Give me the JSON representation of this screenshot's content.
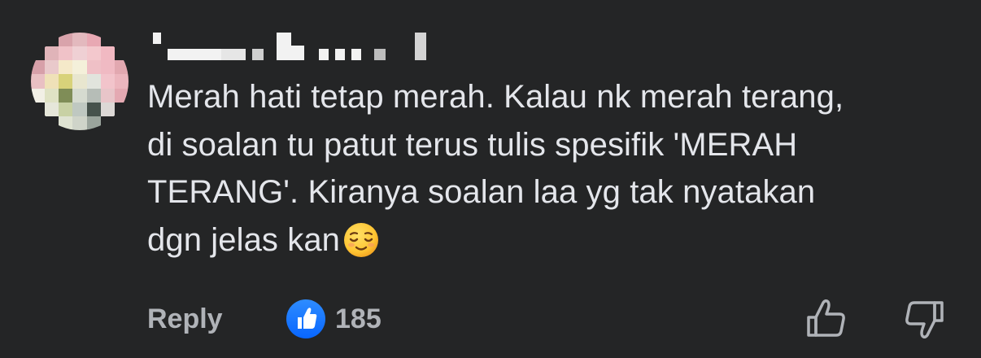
{
  "comment": {
    "author_name": "",
    "text_lines": [
      "Merah hati tetap merah. Kalau nk merah terang,",
      "di soalan tu patut terus tulis spesifik 'MERAH",
      "TERANG'. Kiranya soalan laa yg tak nyatakan",
      "dgn jelas kan"
    ],
    "emoji": "relieved-face-emoji"
  },
  "actions": {
    "reply_label": "Reply",
    "like_icon": "thumbs-up-icon",
    "reaction_count": "185",
    "upvote_icon": "thumbs-up-outline-icon",
    "downvote_icon": "thumbs-down-outline-icon"
  },
  "colors": {
    "background": "#242526",
    "text": "#e4e6eb",
    "secondary_text": "#b0b3b8",
    "like_blue": "#0866ff",
    "emoji_yellow": "#ffcc33"
  }
}
